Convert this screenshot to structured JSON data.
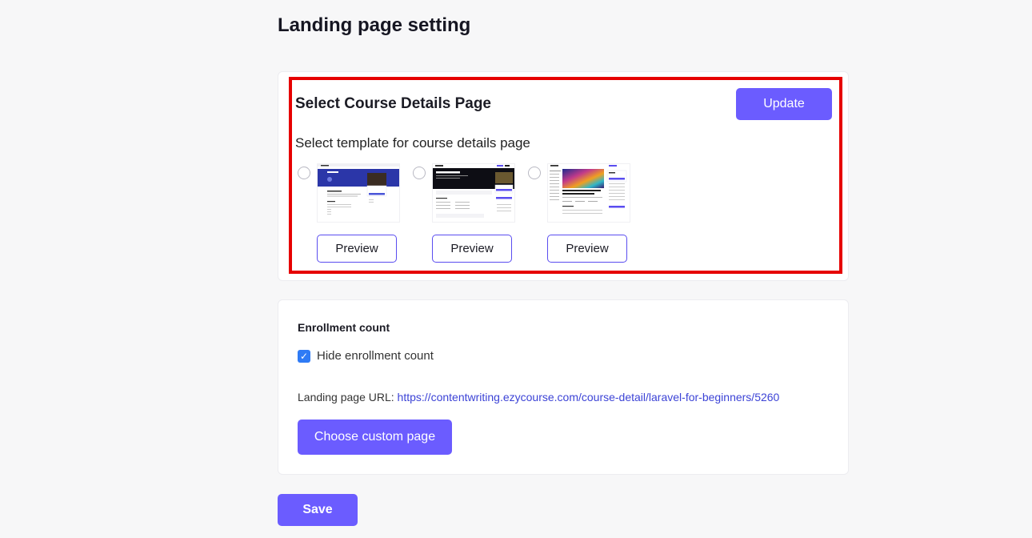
{
  "page": {
    "title": "Landing page setting"
  },
  "templates_section": {
    "title": "Select Course Details Page",
    "update_label": "Update",
    "subtitle": "Select template for course details page",
    "options": [
      {
        "preview_label": "Preview"
      },
      {
        "preview_label": "Preview"
      },
      {
        "preview_label": "Preview"
      }
    ]
  },
  "enrollment": {
    "label": "Enrollment count",
    "checkbox_label": "Hide enrollment count",
    "checked": true,
    "url_label": "Landing page URL:",
    "url": "https://contentwriting.ezycourse.com/course-detail/laravel-for-beginners/5260",
    "custom_page_label": "Choose custom page"
  },
  "save_label": "Save",
  "colors": {
    "accent": "#6b5cff",
    "highlight": "#e60000",
    "link": "#3c43d6",
    "checkbox": "#2f7bf5"
  }
}
